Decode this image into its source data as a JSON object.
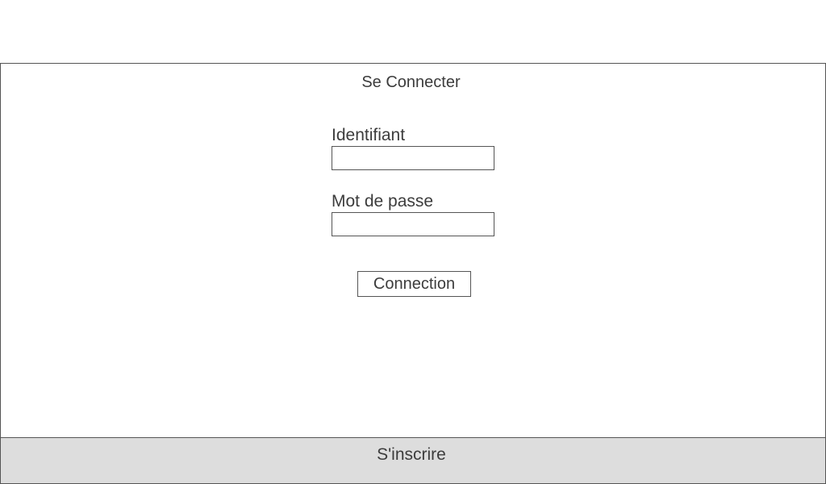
{
  "login": {
    "title": "Se Connecter",
    "username": {
      "label": "Identifiant",
      "value": "",
      "placeholder": ""
    },
    "password": {
      "label": "Mot de passe",
      "value": "",
      "placeholder": ""
    },
    "submit_label": "Connection"
  },
  "footer": {
    "signup_label": "S'inscrire"
  },
  "colors": {
    "border": "#555555",
    "footer_background": "#dddddd",
    "text": "#3c3c3c"
  }
}
